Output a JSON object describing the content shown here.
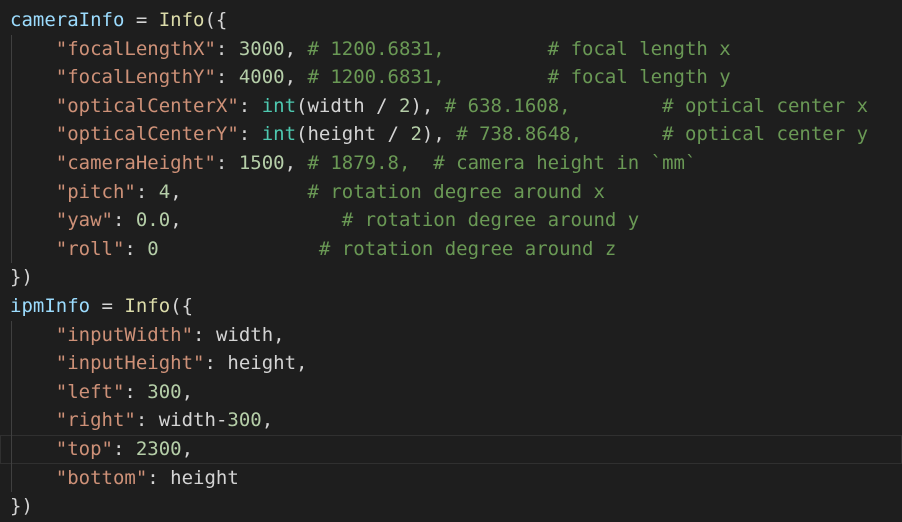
{
  "theme": {
    "background": "#1e1e1e",
    "text": "#d4d4d4",
    "variable": "#9cdcfe",
    "function": "#dcdcaa",
    "string": "#ce9178",
    "number": "#b5cea8",
    "builtin": "#4ec9b0",
    "comment": "#6a9955"
  },
  "code": {
    "camera_info": {
      "var": "cameraInfo",
      "assign": " = ",
      "fn": "Info",
      "open": "({",
      "close": "})",
      "focal_x": {
        "key": "\"focalLengthX\"",
        "colon": ": ",
        "value": "3000",
        "sep": ", ",
        "comment": "# 1200.6831,         # focal length x"
      },
      "focal_y": {
        "key": "\"focalLengthY\"",
        "colon": ": ",
        "value": "4000",
        "sep": ", ",
        "comment": "# 1200.6831,         # focal length y"
      },
      "center_x": {
        "key": "\"opticalCenterX\"",
        "colon": ": ",
        "builtin": "int",
        "arg_open": "(",
        "arg": "width",
        "op": " / ",
        "num": "2",
        "arg_close": ")",
        "sep": ", ",
        "comment": "# 638.1608,        # optical center x"
      },
      "center_y": {
        "key": "\"opticalCenterY\"",
        "colon": ": ",
        "builtin": "int",
        "arg_open": "(",
        "arg": "height",
        "op": " / ",
        "num": "2",
        "arg_close": ")",
        "sep": ", ",
        "comment": "# 738.8648,       # optical center y"
      },
      "cam_height": {
        "key": "\"cameraHeight\"",
        "colon": ": ",
        "value": "1500",
        "sep": ", ",
        "comment": "# 1879.8,  # camera height in `mm`"
      },
      "pitch": {
        "key": "\"pitch\"",
        "colon": ": ",
        "value": "4",
        "sep": ",           ",
        "comment": "# rotation degree around x"
      },
      "yaw": {
        "key": "\"yaw\"",
        "colon": ": ",
        "value": "0.0",
        "sep": ",              ",
        "comment": "# rotation degree around y"
      },
      "roll": {
        "key": "\"roll\"",
        "colon": ": ",
        "value": "0",
        "sep": "              ",
        "comment": "# rotation degree around z"
      }
    },
    "ipm_info": {
      "var": "ipmInfo",
      "assign": " = ",
      "fn": "Info",
      "open": "({",
      "close": "})",
      "input_width": {
        "key": "\"inputWidth\"",
        "colon": ": ",
        "value": "width",
        "sep": ","
      },
      "input_height": {
        "key": "\"inputHeight\"",
        "colon": ": ",
        "value": "height",
        "sep": ","
      },
      "left": {
        "key": "\"left\"",
        "colon": ": ",
        "value": "300",
        "sep": ","
      },
      "right": {
        "key": "\"right\"",
        "colon": ": ",
        "value_var": "width",
        "op": "-",
        "value": "300",
        "sep": ","
      },
      "top": {
        "key": "\"top\"",
        "colon": ": ",
        "value": "2300",
        "sep": ","
      },
      "bottom": {
        "key": "\"bottom\"",
        "colon": ": ",
        "value": "height"
      }
    }
  }
}
